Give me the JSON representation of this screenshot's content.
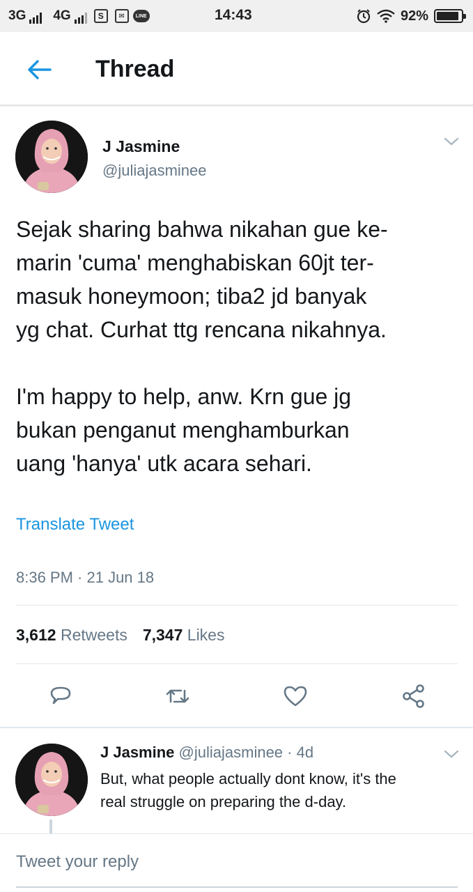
{
  "status_bar": {
    "network1": "3G",
    "network2": "4G",
    "icon_s": "S",
    "icon_line": "LINE",
    "time": "14:43",
    "battery_text": "92%",
    "battery_level": 0.92
  },
  "header": {
    "back_icon": "arrow-left-icon",
    "title": "Thread"
  },
  "tweet": {
    "author_name": "J Jasmine",
    "author_handle": "@juliajasminee",
    "paragraph1": "Sejak sharing bahwa nikahan gue ke-\nmarin 'cuma' menghabiskan 60jt ter-\nmasuk honeymoon; tiba2 jd banyak\nyg chat. Curhat ttg rencana nikahnya.",
    "paragraph2": "I'm happy to help, anw. Krn gue jg\nbukan penganut menghamburkan\nuang 'hanya' utk acara sehari.",
    "translate_label": "Translate Tweet",
    "timestamp": "8:36 PM · 21 Jun 18",
    "retweet_count": "3,612",
    "retweet_label": "Retweets",
    "like_count": "7,347",
    "like_label": "Likes",
    "actions": [
      "reply-icon",
      "retweet-icon",
      "like-icon",
      "share-icon"
    ]
  },
  "reply": {
    "author_name": "J Jasmine",
    "meta": "@juliajasminee · 4d",
    "text": "But, what people actually dont know, it's the\nreal struggle on preparing the d-day."
  },
  "compose": {
    "placeholder": "Tweet your reply"
  },
  "colors": {
    "accent": "#1b95e0",
    "secondary_text": "#657786",
    "divider": "#e1e8ed"
  }
}
